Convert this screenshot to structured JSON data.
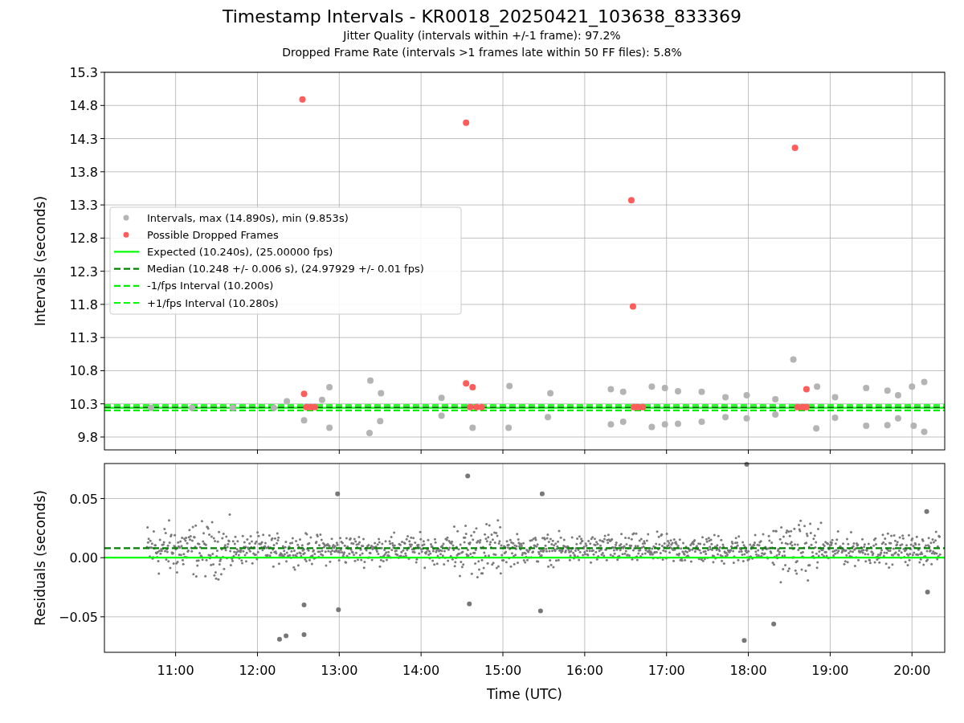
{
  "title": "Timestamp Intervals - KR0018_20250421_103638_833369",
  "subtitles": [
    "Jitter Quality (intervals within +/-1 frame): 97.2%",
    "Dropped Frame Rate (intervals >1 frames late within 50 FF files): 5.8%"
  ],
  "top_panel": {
    "chart_data": {
      "type": "scatter",
      "ylabel": "Intervals (seconds)",
      "xlim": [
        10.13,
        20.4
      ],
      "ylim": [
        9.606,
        15.3
      ],
      "yticks": [
        {
          "value": 9.8,
          "label": "9.8"
        },
        {
          "value": 10.3,
          "label": "10.3"
        },
        {
          "value": 10.8,
          "label": "10.8"
        },
        {
          "value": 11.3,
          "label": "11.3"
        },
        {
          "value": 11.8,
          "label": "11.8"
        },
        {
          "value": 12.3,
          "label": "12.3"
        },
        {
          "value": 12.8,
          "label": "12.8"
        },
        {
          "value": 13.3,
          "label": "13.3"
        },
        {
          "value": 13.8,
          "label": "13.8"
        },
        {
          "value": 14.3,
          "label": "14.3"
        },
        {
          "value": 14.8,
          "label": "14.8"
        },
        {
          "value": 15.3,
          "label": "15.3"
        }
      ],
      "series": [
        {
          "name": "Intervals, max (14.890s), min (9.853s)",
          "color": "#b4b4b4",
          "x": [
            10.7,
            11.2,
            11.7,
            12.2,
            12.36,
            12.57,
            12.79,
            12.88,
            12.88,
            13.37,
            13.38,
            13.5,
            13.51,
            14.25,
            14.25,
            14.63,
            15.07,
            15.08,
            15.55,
            15.58,
            16.32,
            16.32,
            16.47,
            16.47,
            16.82,
            16.82,
            16.98,
            16.98,
            17.14,
            17.14,
            17.43,
            17.43,
            17.72,
            17.72,
            17.98,
            17.98,
            18.33,
            18.33,
            18.55,
            18.83,
            18.84,
            19.06,
            19.06,
            19.44,
            19.44,
            19.7,
            19.7,
            19.83,
            19.83,
            20.0,
            20.02,
            20.15,
            20.15
          ],
          "values": [
            10.24,
            10.24,
            10.24,
            10.24,
            10.34,
            10.05,
            10.36,
            10.55,
            9.94,
            9.86,
            10.65,
            10.04,
            10.46,
            10.39,
            10.12,
            9.94,
            9.94,
            10.57,
            10.1,
            10.46,
            10.52,
            9.99,
            10.48,
            10.03,
            10.56,
            9.95,
            10.54,
            9.99,
            10.49,
            10.0,
            10.48,
            10.03,
            10.4,
            10.1,
            10.43,
            10.08,
            10.37,
            10.14,
            10.97,
            9.93,
            10.56,
            10.4,
            10.09,
            10.54,
            9.97,
            10.5,
            9.98,
            10.43,
            10.08,
            10.56,
            9.97,
            10.63,
            9.88
          ]
        },
        {
          "name": "Possible Dropped Frames",
          "color": "#ff5c5c",
          "x": [
            12.55,
            12.57,
            12.6,
            12.65,
            12.7,
            14.55,
            14.55,
            14.63,
            14.6,
            14.68,
            14.74,
            16.57,
            16.59,
            16.6,
            16.65,
            16.71,
            18.57,
            18.6,
            18.66,
            18.71,
            18.71
          ],
          "values": [
            14.89,
            10.45,
            10.25,
            10.25,
            10.25,
            14.54,
            10.61,
            10.55,
            10.25,
            10.25,
            10.25,
            13.37,
            11.77,
            10.25,
            10.25,
            10.25,
            14.16,
            10.25,
            10.25,
            10.25,
            10.52
          ]
        },
        {
          "name": "Expected (10.240s), (25.00000 fps)",
          "type": "line",
          "line_style": "solid",
          "color": "#00ff00",
          "x": [
            10.13,
            20.4
          ],
          "values": [
            10.24,
            10.24
          ]
        },
        {
          "name": "Median (10.248 +/- 0.006 s), (24.97929 +/- 0.01 fps)",
          "type": "line",
          "line_style": "dashed",
          "color": "#007f00",
          "x": [
            10.13,
            20.4
          ],
          "values": [
            10.248,
            10.248
          ]
        },
        {
          "name": "-1/fps Interval (10.200s)",
          "type": "line",
          "line_style": "dashed",
          "color": "#00ee00",
          "x": [
            10.13,
            20.4
          ],
          "values": [
            10.2,
            10.2
          ]
        },
        {
          "name": "+1/fps Interval (10.280s)",
          "type": "line",
          "line_style": "dashed",
          "color": "#00ff00",
          "x": [
            10.13,
            20.4
          ],
          "values": [
            10.28,
            10.28
          ]
        }
      ],
      "grid": true,
      "legend": "center left"
    }
  },
  "bottom_panel": {
    "chart_data": {
      "type": "scatter",
      "xlabel": "Time (UTC)",
      "ylabel": "Residuals (seconds)",
      "xlim": [
        10.13,
        20.4
      ],
      "ylim": [
        -0.08,
        0.0796
      ],
      "xticks": [
        {
          "value": 11,
          "label": "11:00"
        },
        {
          "value": 12,
          "label": "12:00"
        },
        {
          "value": 13,
          "label": "13:00"
        },
        {
          "value": 14,
          "label": "14:00"
        },
        {
          "value": 15,
          "label": "15:00"
        },
        {
          "value": 16,
          "label": "16:00"
        },
        {
          "value": 17,
          "label": "17:00"
        },
        {
          "value": 18,
          "label": "18:00"
        },
        {
          "value": 19,
          "label": "19:00"
        },
        {
          "value": 20,
          "label": "20:00"
        }
      ],
      "yticks": [
        {
          "value": -0.05,
          "label": "−0.05"
        },
        {
          "value": 0,
          "label": "0.00"
        },
        {
          "value": 0.05,
          "label": "0.05"
        }
      ],
      "series": [
        {
          "color": "#777777",
          "x": [
            12.98,
            14.57,
            15.48,
            17.98,
            20.18,
            12.27,
            12.35,
            12.57,
            12.57,
            12.99,
            14.59,
            15.46,
            17.95,
            18.31,
            20.19
          ],
          "values": [
            0.054,
            0.069,
            0.054,
            0.079,
            0.039,
            -0.069,
            -0.066,
            -0.04,
            -0.065,
            -0.044,
            -0.039,
            -0.045,
            -0.07,
            -0.056,
            -0.029
          ]
        },
        {
          "type": "line",
          "line_style": "solid",
          "color": "#00ff00",
          "x": [
            10.13,
            20.4
          ],
          "values": [
            0,
            0
          ]
        },
        {
          "type": "line",
          "line_style": "dashed",
          "color": "#007f00",
          "x": [
            10.13,
            20.4
          ],
          "values": [
            0.008,
            0.008
          ]
        }
      ],
      "grid": true
    }
  }
}
